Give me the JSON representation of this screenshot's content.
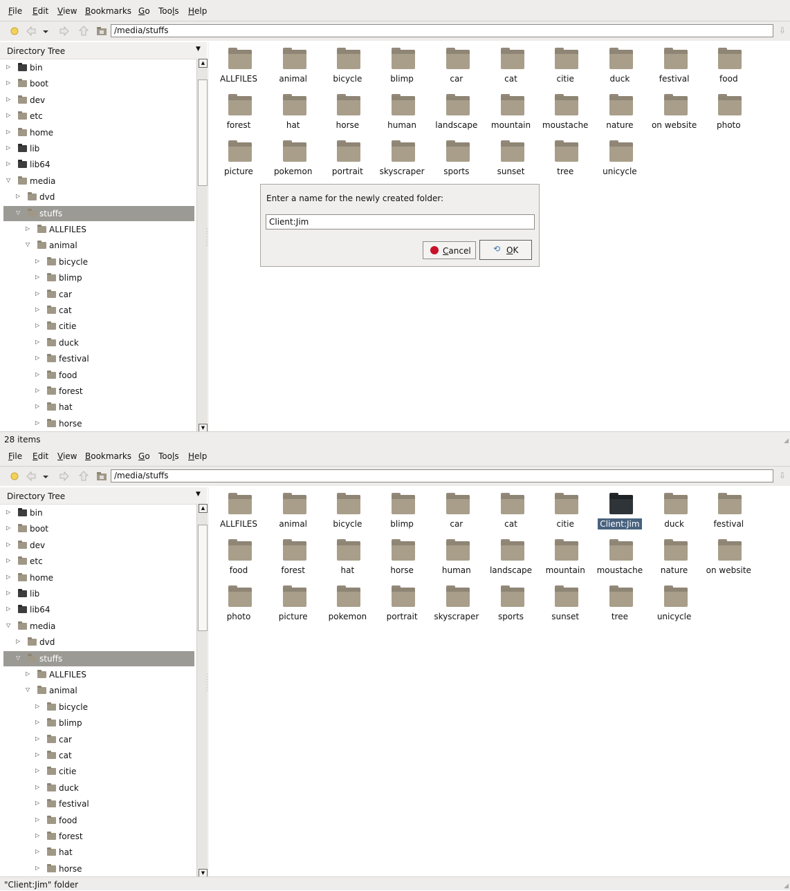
{
  "menu": [
    {
      "pre": "",
      "u": "F",
      "post": "ile"
    },
    {
      "pre": "",
      "u": "E",
      "post": "dit"
    },
    {
      "pre": "",
      "u": "V",
      "post": "iew"
    },
    {
      "pre": "",
      "u": "B",
      "post": "ookmarks"
    },
    {
      "pre": "",
      "u": "G",
      "post": "o"
    },
    {
      "pre": "Too",
      "u": "l",
      "post": "s"
    },
    {
      "pre": "",
      "u": "H",
      "post": "elp"
    }
  ],
  "location": "/media/stuffs",
  "sidebar_title": "Directory Tree",
  "tree": [
    {
      "label": "bin",
      "level": 0,
      "exp": "closed",
      "icon": "dark"
    },
    {
      "label": "boot",
      "level": 0,
      "exp": "closed"
    },
    {
      "label": "dev",
      "level": 0,
      "exp": "closed"
    },
    {
      "label": "etc",
      "level": 0,
      "exp": "closed"
    },
    {
      "label": "home",
      "level": 0,
      "exp": "closed"
    },
    {
      "label": "lib",
      "level": 0,
      "exp": "closed",
      "icon": "dark"
    },
    {
      "label": "lib64",
      "level": 0,
      "exp": "closed",
      "icon": "dark"
    },
    {
      "label": "media",
      "level": 0,
      "exp": "open"
    },
    {
      "label": "dvd",
      "level": 1,
      "exp": "closed"
    },
    {
      "label": "stuffs",
      "level": 1,
      "exp": "open",
      "selected": true
    },
    {
      "label": "ALLFILES",
      "level": 2,
      "exp": "closed"
    },
    {
      "label": "animal",
      "level": 2,
      "exp": "open"
    },
    {
      "label": "bicycle",
      "level": 3,
      "exp": "closed"
    },
    {
      "label": "blimp",
      "level": 3,
      "exp": "closed"
    },
    {
      "label": "car",
      "level": 3,
      "exp": "closed"
    },
    {
      "label": "cat",
      "level": 3,
      "exp": "closed"
    },
    {
      "label": "citie",
      "level": 3,
      "exp": "closed"
    },
    {
      "label": "duck",
      "level": 3,
      "exp": "closed"
    },
    {
      "label": "festival",
      "level": 3,
      "exp": "closed"
    },
    {
      "label": "food",
      "level": 3,
      "exp": "closed"
    },
    {
      "label": "forest",
      "level": 3,
      "exp": "closed"
    },
    {
      "label": "hat",
      "level": 3,
      "exp": "closed"
    },
    {
      "label": "horse",
      "level": 3,
      "exp": "closed"
    }
  ],
  "top": {
    "files": [
      "ALLFILES",
      "animal",
      "bicycle",
      "blimp",
      "car",
      "cat",
      "citie",
      "duck",
      "festival",
      "food",
      "forest",
      "hat",
      "horse",
      "human",
      "landscape",
      "mountain",
      "moustache",
      "nature",
      "on website",
      "photo",
      "picture",
      "pokemon",
      "portrait",
      "skyscraper",
      "sports",
      "sunset",
      "tree",
      "unicycle"
    ],
    "status": "28 items",
    "dialog": {
      "prompt": "Enter a name for the newly created folder:",
      "value": "Client:Jim",
      "cancel_pre": "",
      "cancel_u": "C",
      "cancel_post": "ancel",
      "ok_pre": "",
      "ok_u": "O",
      "ok_post": "K"
    }
  },
  "bottom": {
    "files": [
      "ALLFILES",
      "animal",
      "bicycle",
      "blimp",
      "car",
      "cat",
      "citie",
      "Client:Jim",
      "duck",
      "festival",
      "food",
      "forest",
      "hat",
      "horse",
      "human",
      "landscape",
      "mountain",
      "moustache",
      "nature",
      "on website",
      "photo",
      "picture",
      "pokemon",
      "portrait",
      "skyscraper",
      "sports",
      "sunset",
      "tree",
      "unicycle"
    ],
    "selected": "Client:Jim",
    "status": "\"Client:Jim\" folder"
  }
}
